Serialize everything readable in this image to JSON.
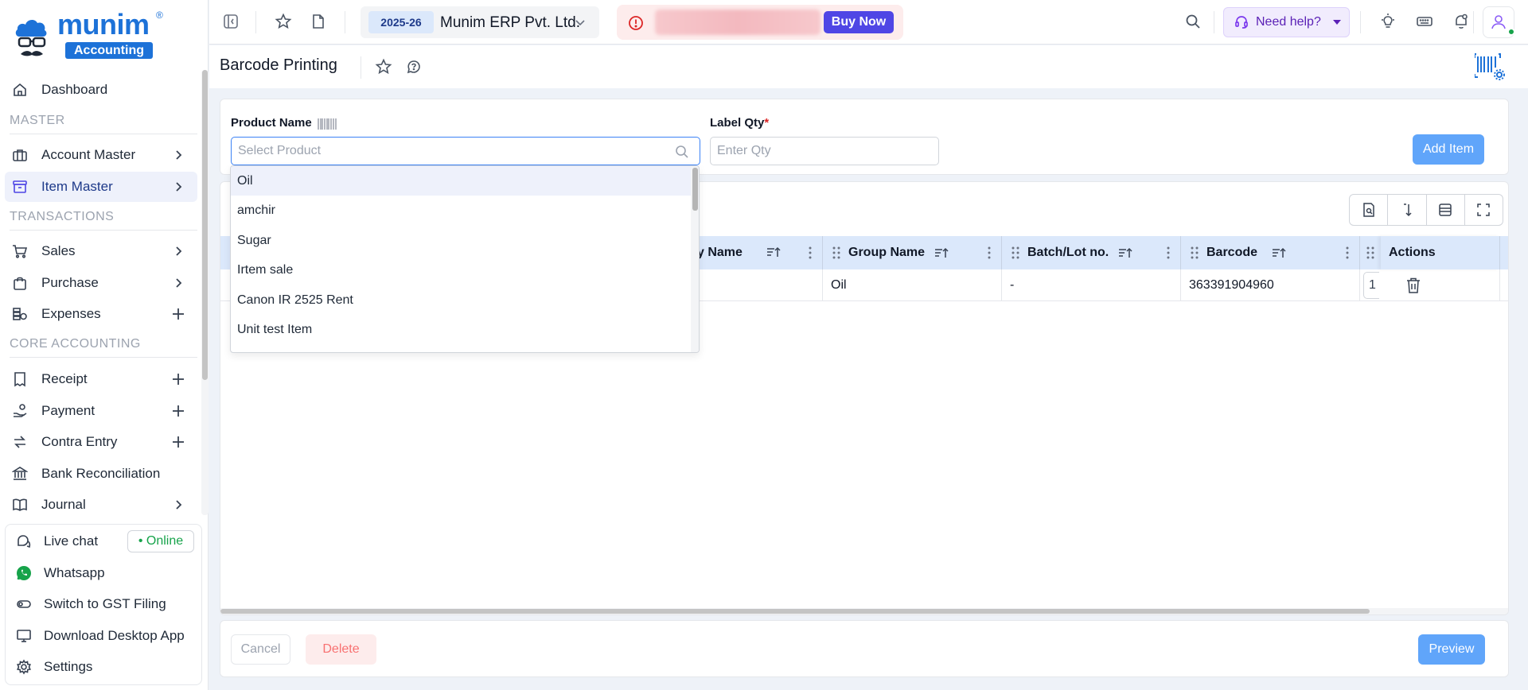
{
  "brand": {
    "logo_text": "munim",
    "logo_sub": "Accounting",
    "colors": {
      "brand_blue": "#1d72d8",
      "accent_indigo": "#4f46e5",
      "primary_light": "#60a5fa",
      "header_blue": "#dbe8fb"
    }
  },
  "sidebar": {
    "items": [
      {
        "label": "Dashboard",
        "icon": "home-icon"
      },
      {
        "label": "Account Master",
        "icon": "briefcase-icon"
      },
      {
        "label": "Item Master",
        "icon": "archive-icon"
      },
      {
        "label": "Sales",
        "icon": "cart-icon"
      },
      {
        "label": "Purchase",
        "icon": "bag-icon"
      },
      {
        "label": "Expenses",
        "icon": "expenses-icon"
      },
      {
        "label": "Receipt",
        "icon": "receipt-icon"
      },
      {
        "label": "Payment",
        "icon": "payment-icon"
      },
      {
        "label": "Contra Entry",
        "icon": "contra-icon"
      },
      {
        "label": "Bank Reconciliation",
        "icon": "bank-icon"
      },
      {
        "label": "Journal",
        "icon": "book-icon"
      }
    ],
    "sections": {
      "master": "MASTER",
      "transactions": "TRANSACTIONS",
      "core": "CORE ACCOUNTING"
    },
    "bottom": {
      "live_chat": "Live chat",
      "online": "• Online",
      "whatsapp": "Whatsapp",
      "gst": "Switch to GST Filing",
      "download": "Download Desktop App",
      "settings": "Settings"
    }
  },
  "topbar": {
    "fy": "2025-26",
    "company": "Munim ERP Pvt. Ltd.",
    "buy_now": "Buy Now",
    "need_help": "Need help?"
  },
  "page": {
    "title": "Barcode Printing"
  },
  "form": {
    "product_label": "Product Name",
    "product_placeholder": "Select Product",
    "qty_label": "Label Qty",
    "qty_required": "*",
    "qty_placeholder": "Enter Qty",
    "add_item": "Add Item"
  },
  "table": {
    "columns": [
      "ory Name",
      "Group Name",
      "Batch/Lot no.",
      "Barcode",
      "Actions"
    ],
    "rows": [
      {
        "group": "Oil",
        "batch": "-",
        "barcode": "363391904960",
        "qty": "1"
      }
    ]
  },
  "dropdown": {
    "options": [
      "Oil",
      "amchir",
      "Sugar",
      "Irtem sale",
      "Canon IR 2525 Rent",
      "Unit test Item"
    ]
  },
  "footer": {
    "cancel": "Cancel",
    "delete": "Delete",
    "preview": "Preview"
  }
}
